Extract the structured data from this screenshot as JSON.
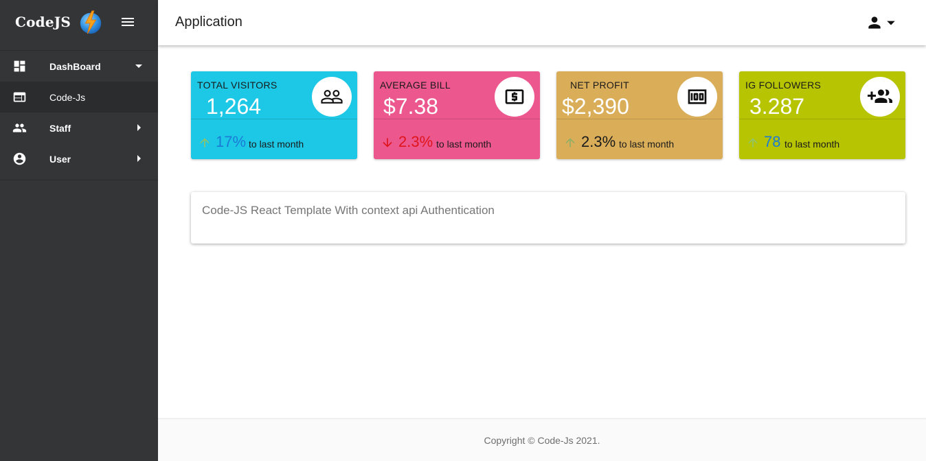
{
  "brand": {
    "name": "CodeJS",
    "logo_icon": "lightning-globe-icon"
  },
  "header": {
    "title": "Application",
    "user_icon": "person-icon"
  },
  "sidebar": {
    "items": [
      {
        "label": "DashBoard",
        "icon": "dashboard-icon",
        "caret": "down"
      },
      {
        "label": "Code-Js",
        "icon": "web-window-icon",
        "active": true
      },
      {
        "label": "Staff",
        "icon": "people-icon",
        "caret": "right"
      },
      {
        "label": "User",
        "icon": "account-circle-icon",
        "caret": "right"
      }
    ]
  },
  "cards": [
    {
      "title": "TOTAL VISITORS",
      "value": "1,264",
      "change": "17%",
      "change_note": "to last month",
      "trend": "up",
      "bg": "#1CC8E6",
      "change_color": "#1a7bd6",
      "arrow_color": "#8fc46b",
      "icon": "people-outline-icon"
    },
    {
      "title": "AVERAGE BILL",
      "value": "$7.38",
      "change": "2.3%",
      "change_note": "to last month",
      "trend": "down",
      "bg": "#EC578E",
      "change_color": "#e0141b",
      "arrow_color": "#e0141b",
      "icon": "dollar-bill-icon"
    },
    {
      "title": "NET PROFIT",
      "value": "$2,390",
      "change": "2.3%",
      "change_note": "to last month",
      "trend": "up",
      "bg": "#DAAE59",
      "change_color": "#1a1a1a",
      "arrow_color": "#8fae66",
      "icon": "money-icon"
    },
    {
      "title": "IG FOLLOWERS",
      "value": "3.287",
      "change": "78",
      "change_note": "to last month",
      "trend": "up",
      "bg": "#B7C402",
      "change_color": "#1a7bd6",
      "arrow_color": "#8fc46b",
      "icon": "group-add-icon"
    }
  ],
  "panel": {
    "text": "Code-JS React Template With context api Authentication"
  },
  "footer": {
    "copyright": "Copyright © Code-Js 2021."
  }
}
